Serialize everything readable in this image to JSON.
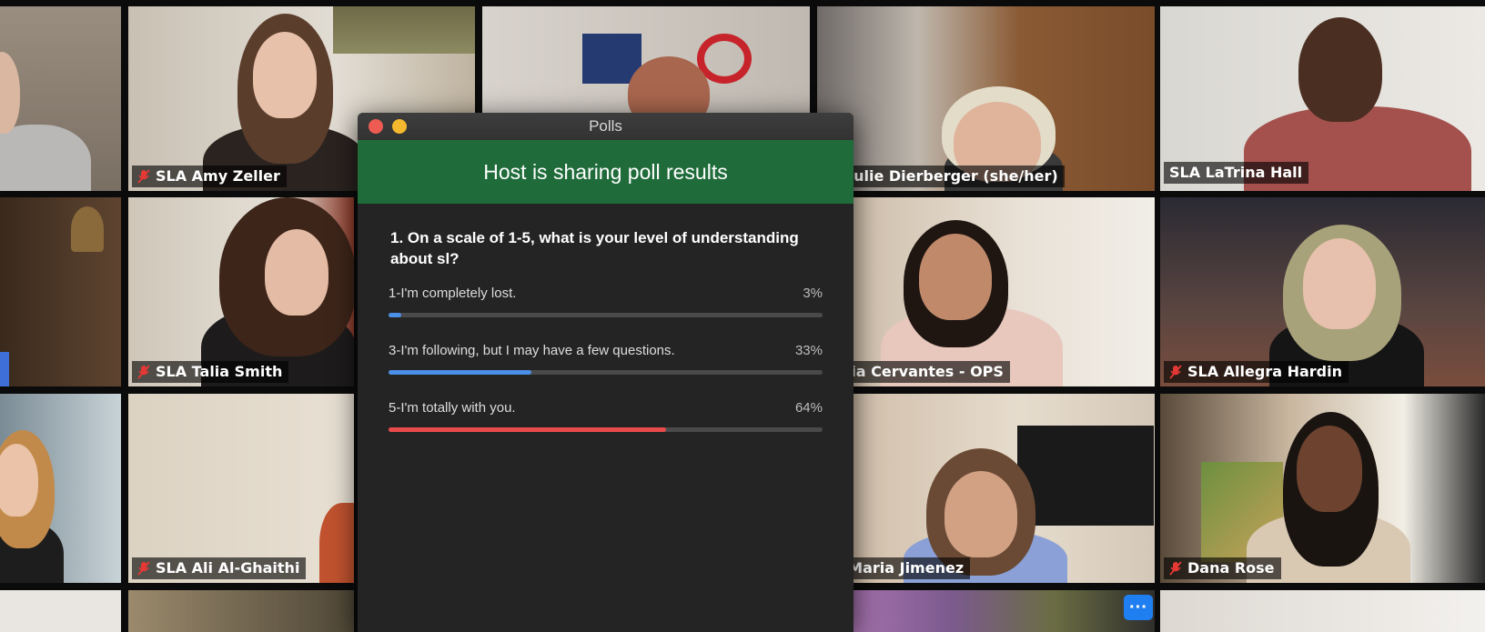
{
  "polls": {
    "window_title": "Polls",
    "banner": "Host is sharing poll results",
    "question": "1. On a scale of 1-5, what is your level of understanding about sl?",
    "options": [
      {
        "label": "1-I'm completely lost.",
        "percent_label": "3%",
        "percent": 3,
        "color": "#4a8fe8"
      },
      {
        "label": "3-I'm following, but I may have a few questions.",
        "percent_label": "33%",
        "percent": 33,
        "color": "#4a8fe8"
      },
      {
        "label": "5-I'm totally with you.",
        "percent_label": "64%",
        "percent": 64,
        "color": "#e94b4b"
      }
    ],
    "colors": {
      "close": "#ee5b52",
      "minimize": "#f3b82e",
      "banner": "#1f6b3a"
    }
  },
  "participants": [
    {
      "name": "SLA Amy Zeller",
      "muted": true
    },
    {
      "name": "LA Julie Dierberger (she/her)",
      "muted": false
    },
    {
      "name": "SLA LaTrina Hall",
      "muted": false,
      "active_speaker": true
    },
    {
      "name": "SLA Talia Smith",
      "muted": true
    },
    {
      "name": "elicia Cervantes - OPS",
      "muted": false
    },
    {
      "name": "SLA Allegra Hardin",
      "muted": true
    },
    {
      "name": "SLA Ali Al-Ghaithi",
      "muted": true
    },
    {
      "name": "LA Maria Jimenez",
      "muted": false
    },
    {
      "name": "Dana Rose",
      "muted": true
    }
  ],
  "more_button": {
    "label": "···",
    "icon": "more-options-icon"
  }
}
